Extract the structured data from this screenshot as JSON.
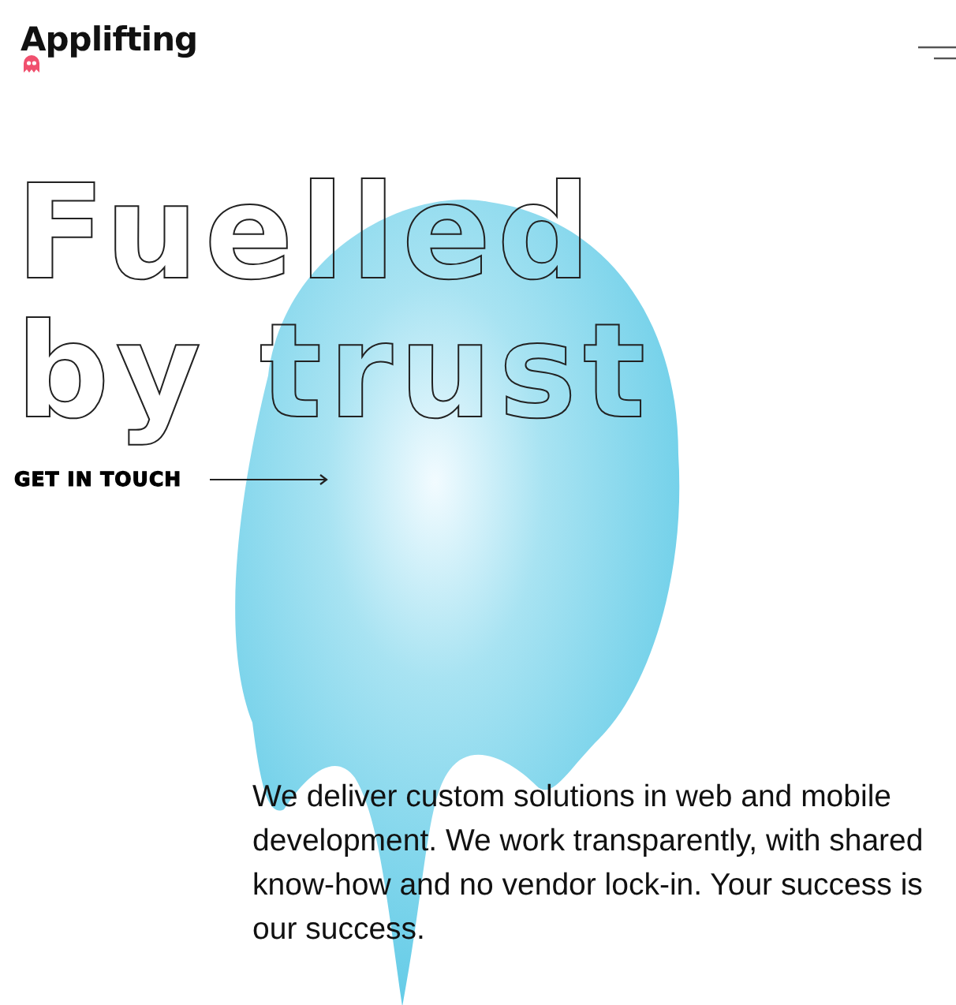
{
  "header": {
    "logo": "Applifting"
  },
  "hero": {
    "headline_lines": [
      "Fuelled",
      "by trust"
    ],
    "cta": "GET IN TOUCH",
    "description": "We deliver custom solutions in web and mobile development. We work transparently, with shared know-how and no vendor lock-in. Your success is our success."
  }
}
